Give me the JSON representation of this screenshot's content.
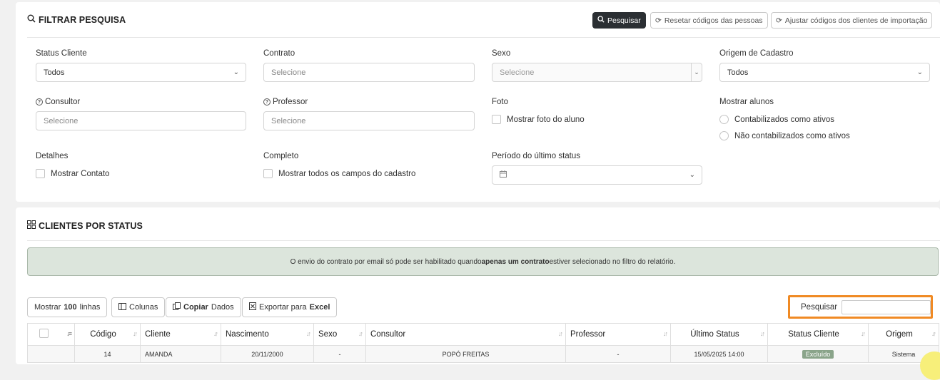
{
  "filter": {
    "title": "FILTRAR PESQUISA",
    "buttons": {
      "search": "Pesquisar",
      "reset_codes": "Resetar códigos das pessoas",
      "adjust_codes": "Ajustar códigos dos clientes de importação"
    },
    "fields": {
      "status_cliente": {
        "label": "Status Cliente",
        "value": "Todos"
      },
      "contrato": {
        "label": "Contrato",
        "placeholder": "Selecione"
      },
      "sexo": {
        "label": "Sexo",
        "placeholder": "Selecione"
      },
      "origem": {
        "label": "Origem de Cadastro",
        "value": "Todos"
      },
      "consultor": {
        "label": "Consultor",
        "placeholder": "Selecione"
      },
      "professor": {
        "label": "Professor",
        "placeholder": "Selecione"
      },
      "foto": {
        "label": "Foto",
        "option": "Mostrar foto do aluno"
      },
      "mostrar_alunos": {
        "label": "Mostrar alunos",
        "options": [
          "Contabilizados como ativos",
          "Não contabilizados como ativos"
        ]
      },
      "detalhes": {
        "label": "Detalhes",
        "option": "Mostrar Contato"
      },
      "completo": {
        "label": "Completo",
        "option": "Mostrar todos os campos do cadastro"
      },
      "periodo": {
        "label": "Período do último status"
      }
    }
  },
  "clients": {
    "title": "CLIENTES POR STATUS",
    "alert": {
      "before": "O envio do contrato por email só pode ser habilitado quando ",
      "bold": "apenas um contrato",
      "after": " estiver selecionado no filtro do relatório."
    },
    "toolbar": {
      "show_prefix": "Mostrar ",
      "show_count": "100",
      "show_suffix": " linhas",
      "columns": "Colunas",
      "copy_bold": "Copiar",
      "copy_rest": " Dados",
      "export_prefix": "Exportar para ",
      "export_bold": "Excel"
    },
    "search_label": "Pesquisar",
    "columns": [
      "Código",
      "Cliente",
      "Nascimento",
      "Sexo",
      "Consultor",
      "Professor",
      "Último Status",
      "Status Cliente",
      "Origem"
    ],
    "rows": [
      {
        "codigo": "14",
        "cliente": "AMANDA",
        "nascimento": "20/11/2000",
        "sexo": "-",
        "consultor": "POPÓ FREITAS",
        "professor": "-",
        "ultimo_status": "15/05/2025 14:00",
        "status_cliente": "Excluído",
        "origem": "Sistema"
      }
    ]
  },
  "colors": {
    "accent_dark": "#2b2f33",
    "highlight": "#f08a24",
    "alert_bg": "#dce5dc",
    "badge": "#8aa48a"
  }
}
